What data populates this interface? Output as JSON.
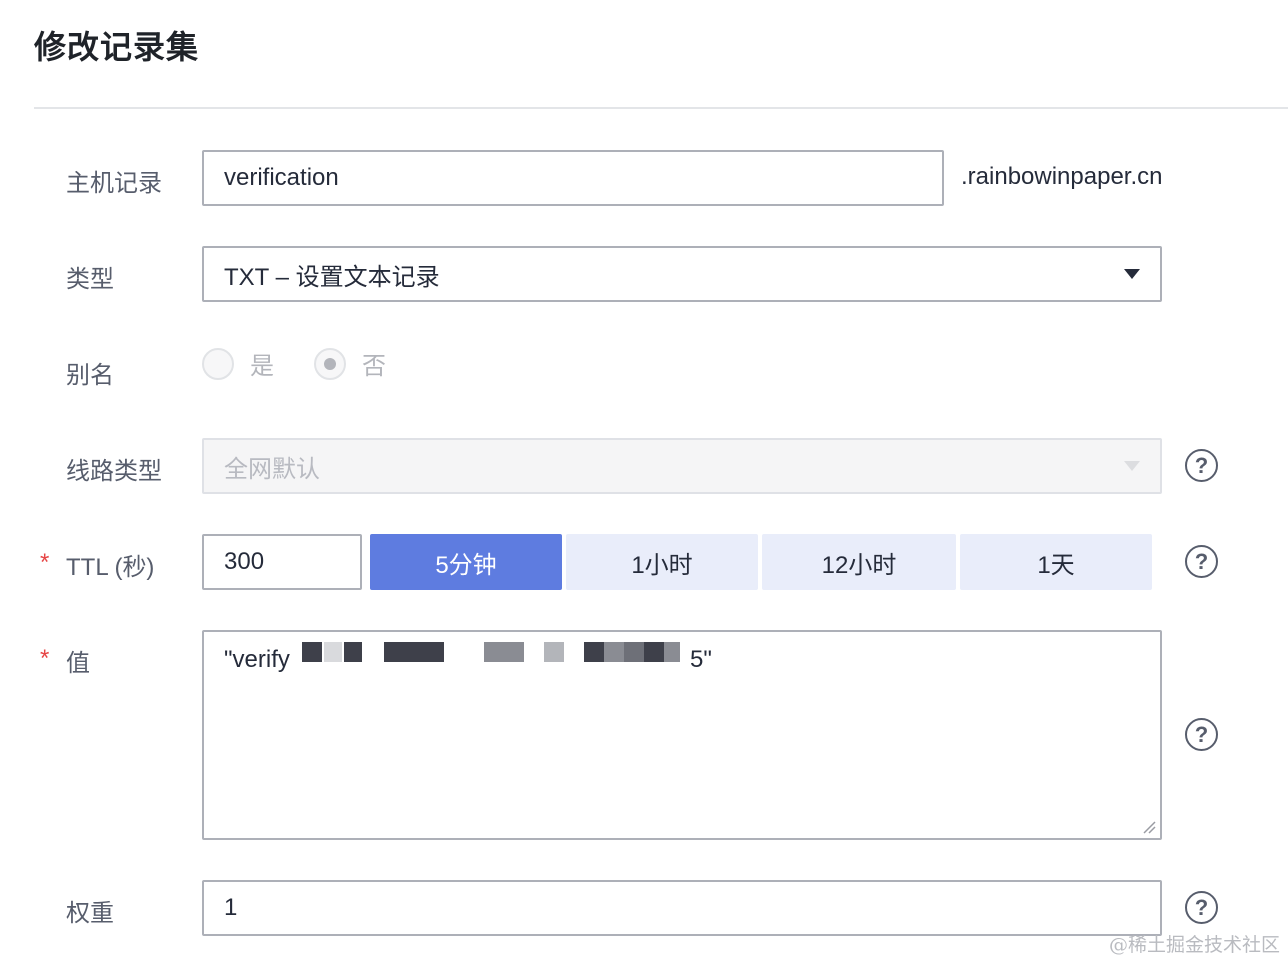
{
  "dialog": {
    "title": "修改记录集"
  },
  "form": {
    "host_record": {
      "label": "主机记录",
      "value": "verification",
      "suffix": ".rainbowinpaper.cn"
    },
    "type": {
      "label": "类型",
      "value": "TXT – 设置文本记录"
    },
    "alias": {
      "label": "别名",
      "options": [
        "是",
        "否"
      ],
      "selected": "否"
    },
    "line_type": {
      "label": "线路类型",
      "value": "全网默认"
    },
    "ttl": {
      "required_mark": "*",
      "label": "TTL (秒)",
      "value": "300",
      "presets": [
        "5分钟",
        "1小时",
        "12小时",
        "1天"
      ],
      "selected_preset": "5分钟"
    },
    "value": {
      "required_mark": "*",
      "label": "值",
      "text_start": "\"verify",
      "text_end": "5\""
    },
    "weight": {
      "label": "权重",
      "value": "1"
    },
    "help_icon": "?"
  },
  "watermark": "@稀土掘金技术社区",
  "colors": {
    "primary": "#5e7ce0",
    "preset_bg": "#e9edfa",
    "required": "#e64545",
    "border": "#adb0b8"
  }
}
